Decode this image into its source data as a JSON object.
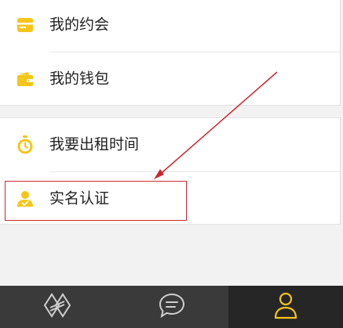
{
  "menu_group_1": {
    "items": [
      {
        "label": "我的约会",
        "icon": "card-icon"
      },
      {
        "label": "我的钱包",
        "icon": "wallet-icon"
      }
    ]
  },
  "menu_group_2": {
    "items": [
      {
        "label": "我要出租时间",
        "icon": "stopwatch-icon"
      },
      {
        "label": "实名认证",
        "icon": "user-verified-icon"
      }
    ]
  },
  "tabbar": {
    "tabs": [
      {
        "icon": "home-logo-icon",
        "active": false
      },
      {
        "icon": "chat-bubble-icon",
        "active": false
      },
      {
        "icon": "profile-icon",
        "active": true
      }
    ]
  },
  "colors": {
    "accent": "#f5c518",
    "annotation": "#c8282f",
    "tabbar_bg": "#3a3a3a",
    "tabbar_active_bg": "#262626",
    "tab_icon": "#cfcfcf"
  }
}
